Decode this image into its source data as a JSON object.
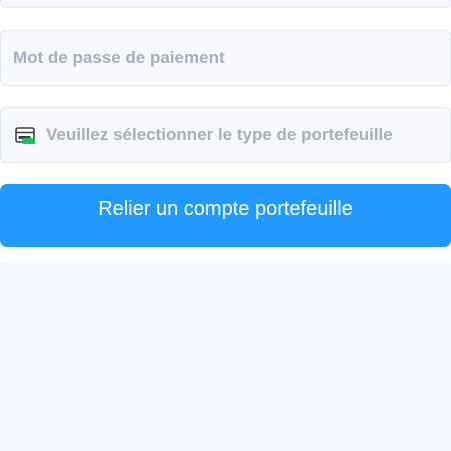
{
  "form": {
    "payment_password": {
      "placeholder": "Mot de passe de paiement",
      "value": ""
    },
    "wallet_type": {
      "placeholder": "Veuillez sélectionner le type de portefeuille",
      "icon": "wallet-card-icon"
    },
    "submit_label": "Relier un compte portefeuille"
  },
  "colors": {
    "primary": "#2299fd",
    "field_background": "#f6f8fd",
    "placeholder_text": "#a7afbf",
    "icon_green": "#1fbf5f"
  }
}
